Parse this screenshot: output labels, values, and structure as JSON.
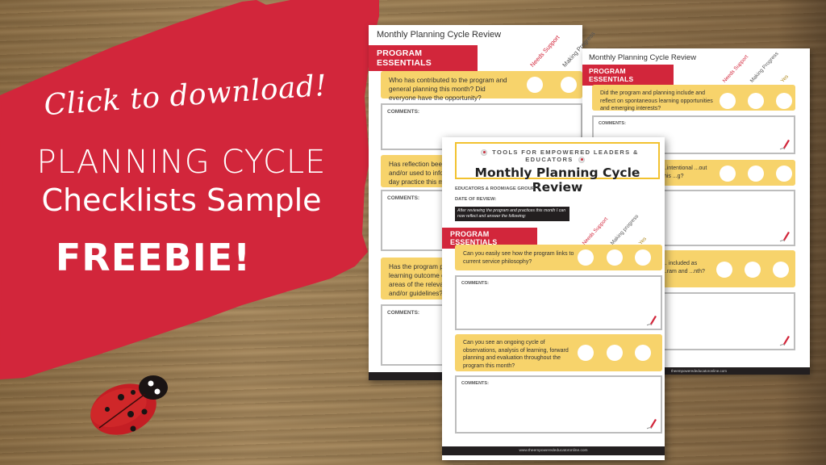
{
  "promo": {
    "call_to_action": "Click to download!",
    "headline_line1": "PLANNING CYCLE",
    "headline_line2": "Checklists Sample",
    "badge": "FREEBIE!"
  },
  "colors": {
    "brand_red": "#d2263b",
    "question_yellow": "#f7d36b",
    "header_gold": "#f2c230",
    "footer_dark": "#231f20"
  },
  "pages": {
    "back_left": {
      "title": "Monthly Planning Cycle Review",
      "section": "PROGRAM ESSENTIALS",
      "columns": [
        "Needs Support",
        "Making Progress"
      ],
      "questions": [
        {
          "text": "Who has contributed to the program and general planning this month? Did everyone have the opportunity?",
          "comments_label": "COMMENTS:"
        },
        {
          "text": "Has reflection been ... and/or used to infor... day practice this mo...",
          "comments_label": "COMMENTS:"
        },
        {
          "text": "Has the program pr... learning outcome o... areas of the relevan... and/or guidelines?",
          "comments_label": "COMMENTS:"
        }
      ]
    },
    "back_right": {
      "title": "Monthly Planning Cycle Review",
      "section": "PROGRAM ESSENTIALS",
      "columns": [
        "Needs Support",
        "Making Progress",
        "Yes"
      ],
      "questions": [
        {
          "text": "Did the program and planning include and reflect on spontaneous learning opportunities and emerging interests?",
          "comments_label": "COMMENTS:"
        },
        {
          "text": "...intentional ...out this ...g?",
          "comments_label": ""
        },
        {
          "text": "... included as ...ram and ...nth?",
          "comments_label": ""
        }
      ],
      "footer": "theempowerededucatoronline.com"
    },
    "front": {
      "tagline": "TOOLS FOR EMPOWERED LEADERS & EDUCATORS",
      "title": "Monthly Planning Cycle Review",
      "field_educators": "EDUCATORS & ROOM/AGE GROUP:",
      "field_date": "DATE OF REVIEW:",
      "instruction": "After reviewing the program and practices this month I can now reflect and answer the following:",
      "section": "PROGRAM ESSENTIALS",
      "columns": [
        "Needs Support",
        "Making progress",
        "Yes"
      ],
      "questions": [
        {
          "text": "Can you easily see how the program links to current service philosophy?",
          "comments_label": "COMMENTS:"
        },
        {
          "text": "Can you see an ongoing cycle of observations, analysis of learning, forward planning and evaluation throughout the program this month?",
          "comments_label": "COMMENTS:"
        }
      ],
      "footer": "www.theempowerededucatoronline.com"
    }
  }
}
